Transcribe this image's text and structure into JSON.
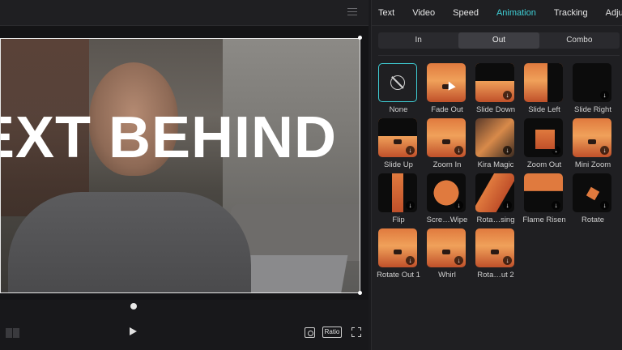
{
  "player": {
    "overlay_text": "EXT BEHIND",
    "ratio_label": "Ratio"
  },
  "panel": {
    "tabs": [
      {
        "label": "Text",
        "active": false
      },
      {
        "label": "Video",
        "active": false
      },
      {
        "label": "Speed",
        "active": false
      },
      {
        "label": "Animation",
        "active": true
      },
      {
        "label": "Tracking",
        "active": false
      },
      {
        "label": "Adjustmen",
        "active": false
      }
    ],
    "segments": [
      {
        "label": "In",
        "active": false
      },
      {
        "label": "Out",
        "active": true
      },
      {
        "label": "Combo",
        "active": false
      }
    ],
    "animations": [
      {
        "label": "None",
        "selected": true
      },
      {
        "label": "Fade Out"
      },
      {
        "label": "Slide Down"
      },
      {
        "label": "Slide Left"
      },
      {
        "label": "Slide Right"
      },
      {
        "label": "Slide Up"
      },
      {
        "label": "Zoom In"
      },
      {
        "label": "Kira Magic"
      },
      {
        "label": "Zoom Out"
      },
      {
        "label": "Mini Zoom"
      },
      {
        "label": "Flip"
      },
      {
        "label": "Scre…Wipe"
      },
      {
        "label": "Rota…sing"
      },
      {
        "label": "Flame Risen"
      },
      {
        "label": "Rotate"
      },
      {
        "label": "Rotate Out 1"
      },
      {
        "label": "Whirl"
      },
      {
        "label": "Rota…ut 2"
      }
    ]
  },
  "colors": {
    "accent": "#3fd0d7",
    "panel_bg": "#1f1f22"
  }
}
